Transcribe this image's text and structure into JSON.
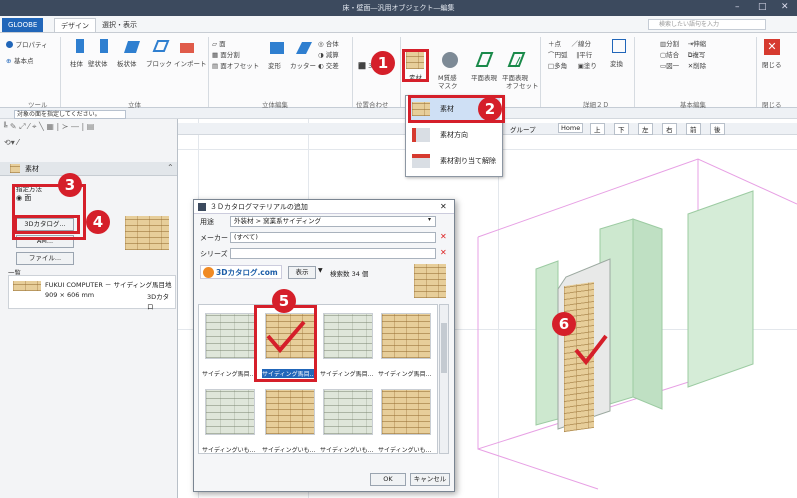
{
  "window": {
    "title": "床・壁面―汎用オブジェクト―編集",
    "min": "–",
    "max": "□",
    "close": "✕"
  },
  "tabs": [
    "GLOOBE",
    "デザイン",
    "選択・表示"
  ],
  "search_placeholder": "検索したい語句を入力",
  "ribbon": {
    "properties": "プロパティ",
    "basepoint": "基本点",
    "tool_group": "ツール",
    "solid_items": [
      "柱体",
      "壁状体",
      "板状体",
      "ブロック",
      "インポート"
    ],
    "solid_group": "立体",
    "face_items": [
      "面",
      "面分割",
      "面オフセット"
    ],
    "solid_edit_items": [
      "変形",
      "カッター"
    ],
    "bool_items": [
      "合体",
      "減算",
      "交差"
    ],
    "solid_edit_group": "立体編集",
    "align_items": [
      "3D回転"
    ],
    "align_group": "位置合わせ",
    "material": "素材",
    "m_texture": "M質感",
    "m_texture2": "マスク",
    "plane_expr": "平面表現",
    "plane_expr2": "平面表現",
    "plane_expr2b": "オフセット",
    "draw_items": [
      "点",
      "線分",
      "円弧",
      "平行",
      "多角",
      "塗り"
    ],
    "convert": "変換",
    "detail2d_group": "詳細２Ｄ",
    "basic_items": [
      "分割",
      "伸縮",
      "結合",
      "複写",
      "図一",
      "削除"
    ],
    "basic_group": "基本編集",
    "close": "閉じる",
    "close_group": "閉じる"
  },
  "hint": "対象の面を指定してください。",
  "view_tabs": [
    "グループ",
    "Home",
    "上",
    "下",
    "左",
    "右",
    "前",
    "後"
  ],
  "menu": {
    "items": [
      "素材",
      "素材方向",
      "素材割り当て解除"
    ]
  },
  "panel": {
    "title": "素材",
    "mode_label": "指定方法",
    "mode_opt1": "面",
    "catalog_btn": "3Dカタログ...",
    "am_btn": "AM...",
    "file_btn": "ファイル...",
    "list_label": "一覧",
    "item_name": "FUKUI COMPUTER － サイディング馬目地",
    "item_size": "909 × 606 mm",
    "item_src": "3Dカタロ"
  },
  "dialog": {
    "title": "３Ｄカタログマテリアルの追加",
    "usage_label": "用途",
    "usage_value": "外装材 > 窯業系サイディング",
    "maker_label": "メーカー",
    "maker_value": "(すべて)",
    "series_label": "シリーズ",
    "series_value": "",
    "logo": "3Dカタログ.com",
    "display_btn": "表示",
    "result": "検索数 34 個",
    "thumbs_row1": [
      "サイディング馬目...",
      "サイディング馬目...",
      "サイディング馬目...",
      "サイディング馬目..."
    ],
    "thumbs_row2": [
      "サイディングいも...",
      "サイディングいも...",
      "サイディングいも...",
      "サイディングいも..."
    ],
    "ok": "OK",
    "cancel": "キャンセル"
  },
  "badges": [
    "1",
    "2",
    "3",
    "4",
    "5",
    "6"
  ],
  "colors": {
    "accent": "#2166b9",
    "badge": "#d51f2a",
    "solid": "#cde8cf"
  }
}
